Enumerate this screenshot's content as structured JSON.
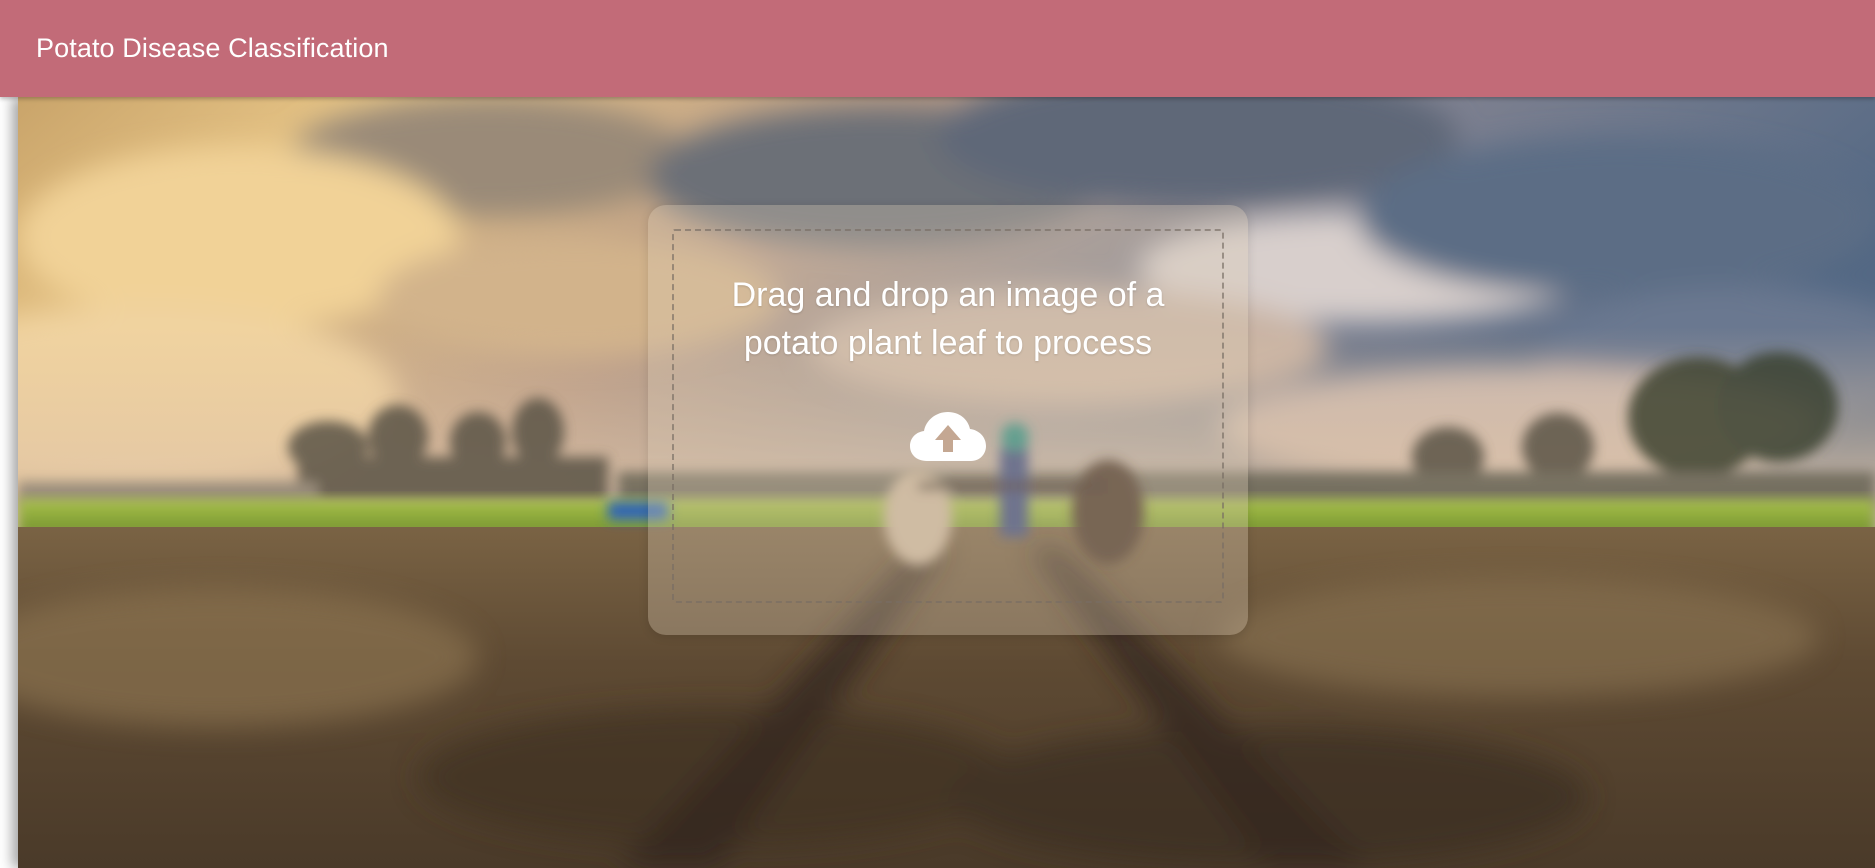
{
  "app_bar": {
    "title": "Potato Disease Classification",
    "color": "#c26b78"
  },
  "dropzone": {
    "instruction": "Drag and drop an image of a potato plant leaf to process",
    "icon": "cloud-upload-icon"
  },
  "background": {
    "description_icon": "farm-field-background"
  }
}
